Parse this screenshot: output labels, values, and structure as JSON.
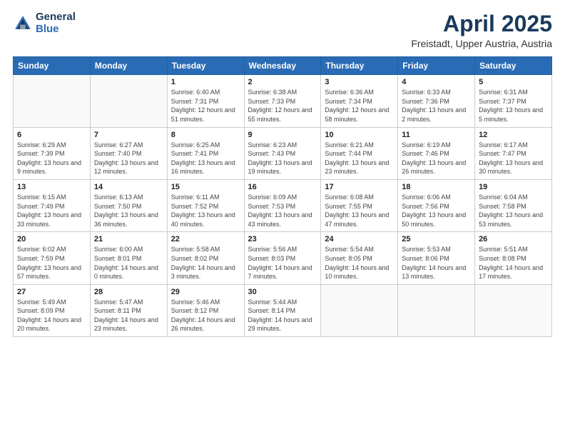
{
  "logo": {
    "line1": "General",
    "line2": "Blue"
  },
  "header": {
    "month": "April 2025",
    "location": "Freistadt, Upper Austria, Austria"
  },
  "weekdays": [
    "Sunday",
    "Monday",
    "Tuesday",
    "Wednesday",
    "Thursday",
    "Friday",
    "Saturday"
  ],
  "weeks": [
    [
      {
        "day": "",
        "info": ""
      },
      {
        "day": "",
        "info": ""
      },
      {
        "day": "1",
        "info": "Sunrise: 6:40 AM\nSunset: 7:31 PM\nDaylight: 12 hours and 51 minutes."
      },
      {
        "day": "2",
        "info": "Sunrise: 6:38 AM\nSunset: 7:33 PM\nDaylight: 12 hours and 55 minutes."
      },
      {
        "day": "3",
        "info": "Sunrise: 6:36 AM\nSunset: 7:34 PM\nDaylight: 12 hours and 58 minutes."
      },
      {
        "day": "4",
        "info": "Sunrise: 6:33 AM\nSunset: 7:36 PM\nDaylight: 13 hours and 2 minutes."
      },
      {
        "day": "5",
        "info": "Sunrise: 6:31 AM\nSunset: 7:37 PM\nDaylight: 13 hours and 5 minutes."
      }
    ],
    [
      {
        "day": "6",
        "info": "Sunrise: 6:29 AM\nSunset: 7:39 PM\nDaylight: 13 hours and 9 minutes."
      },
      {
        "day": "7",
        "info": "Sunrise: 6:27 AM\nSunset: 7:40 PM\nDaylight: 13 hours and 12 minutes."
      },
      {
        "day": "8",
        "info": "Sunrise: 6:25 AM\nSunset: 7:41 PM\nDaylight: 13 hours and 16 minutes."
      },
      {
        "day": "9",
        "info": "Sunrise: 6:23 AM\nSunset: 7:43 PM\nDaylight: 13 hours and 19 minutes."
      },
      {
        "day": "10",
        "info": "Sunrise: 6:21 AM\nSunset: 7:44 PM\nDaylight: 13 hours and 23 minutes."
      },
      {
        "day": "11",
        "info": "Sunrise: 6:19 AM\nSunset: 7:46 PM\nDaylight: 13 hours and 26 minutes."
      },
      {
        "day": "12",
        "info": "Sunrise: 6:17 AM\nSunset: 7:47 PM\nDaylight: 13 hours and 30 minutes."
      }
    ],
    [
      {
        "day": "13",
        "info": "Sunrise: 6:15 AM\nSunset: 7:49 PM\nDaylight: 13 hours and 33 minutes."
      },
      {
        "day": "14",
        "info": "Sunrise: 6:13 AM\nSunset: 7:50 PM\nDaylight: 13 hours and 36 minutes."
      },
      {
        "day": "15",
        "info": "Sunrise: 6:11 AM\nSunset: 7:52 PM\nDaylight: 13 hours and 40 minutes."
      },
      {
        "day": "16",
        "info": "Sunrise: 6:09 AM\nSunset: 7:53 PM\nDaylight: 13 hours and 43 minutes."
      },
      {
        "day": "17",
        "info": "Sunrise: 6:08 AM\nSunset: 7:55 PM\nDaylight: 13 hours and 47 minutes."
      },
      {
        "day": "18",
        "info": "Sunrise: 6:06 AM\nSunset: 7:56 PM\nDaylight: 13 hours and 50 minutes."
      },
      {
        "day": "19",
        "info": "Sunrise: 6:04 AM\nSunset: 7:58 PM\nDaylight: 13 hours and 53 minutes."
      }
    ],
    [
      {
        "day": "20",
        "info": "Sunrise: 6:02 AM\nSunset: 7:59 PM\nDaylight: 13 hours and 57 minutes."
      },
      {
        "day": "21",
        "info": "Sunrise: 6:00 AM\nSunset: 8:01 PM\nDaylight: 14 hours and 0 minutes."
      },
      {
        "day": "22",
        "info": "Sunrise: 5:58 AM\nSunset: 8:02 PM\nDaylight: 14 hours and 3 minutes."
      },
      {
        "day": "23",
        "info": "Sunrise: 5:56 AM\nSunset: 8:03 PM\nDaylight: 14 hours and 7 minutes."
      },
      {
        "day": "24",
        "info": "Sunrise: 5:54 AM\nSunset: 8:05 PM\nDaylight: 14 hours and 10 minutes."
      },
      {
        "day": "25",
        "info": "Sunrise: 5:53 AM\nSunset: 8:06 PM\nDaylight: 14 hours and 13 minutes."
      },
      {
        "day": "26",
        "info": "Sunrise: 5:51 AM\nSunset: 8:08 PM\nDaylight: 14 hours and 17 minutes."
      }
    ],
    [
      {
        "day": "27",
        "info": "Sunrise: 5:49 AM\nSunset: 8:09 PM\nDaylight: 14 hours and 20 minutes."
      },
      {
        "day": "28",
        "info": "Sunrise: 5:47 AM\nSunset: 8:11 PM\nDaylight: 14 hours and 23 minutes."
      },
      {
        "day": "29",
        "info": "Sunrise: 5:46 AM\nSunset: 8:12 PM\nDaylight: 14 hours and 26 minutes."
      },
      {
        "day": "30",
        "info": "Sunrise: 5:44 AM\nSunset: 8:14 PM\nDaylight: 14 hours and 29 minutes."
      },
      {
        "day": "",
        "info": ""
      },
      {
        "day": "",
        "info": ""
      },
      {
        "day": "",
        "info": ""
      }
    ]
  ]
}
